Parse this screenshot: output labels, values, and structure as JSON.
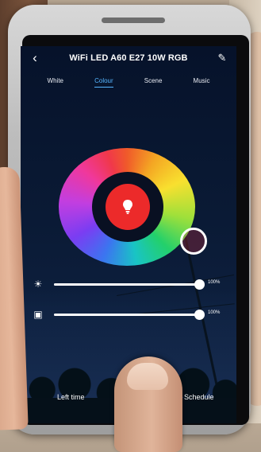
{
  "header": {
    "title": "WiFi LED A60 E27 10W RGB",
    "back_icon": "chevron-left-icon",
    "edit_icon": "pencil-icon"
  },
  "tabs": [
    {
      "label": "White",
      "active": false
    },
    {
      "label": "Colour",
      "active": true
    },
    {
      "label": "Scene",
      "active": false
    },
    {
      "label": "Music",
      "active": false
    }
  ],
  "color_wheel": {
    "selected_color": "#ec2a2a",
    "center_icon": "bulb-icon"
  },
  "sliders": [
    {
      "icon": "brightness-icon",
      "percent_text": "100%",
      "value": 1.0
    },
    {
      "icon": "saturation-icon",
      "percent_text": "100%",
      "value": 1.0
    }
  ],
  "bottom": {
    "left_time": "Left time",
    "schedule": "Schedule"
  },
  "colors": {
    "accent": "#56b6ff",
    "screen_bg": "#06122a",
    "text": "#ffffff"
  }
}
